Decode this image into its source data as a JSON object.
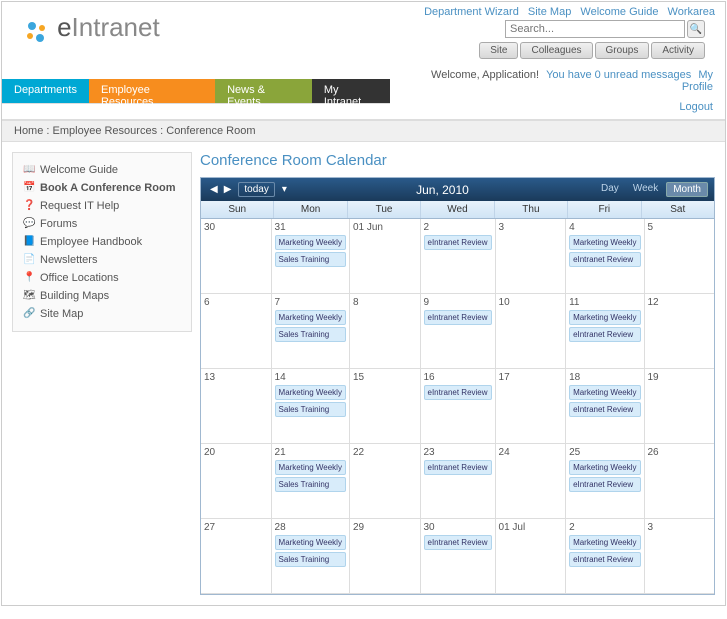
{
  "topLinks": {
    "deptWizard": "Department Wizard",
    "siteMap": "Site Map",
    "welcomeGuide": "Welcome Guide",
    "workarea": "Workarea"
  },
  "search": {
    "placeholder": "Search..."
  },
  "filterTabs": {
    "site": "Site",
    "colleagues": "Colleagues",
    "groups": "Groups",
    "activity": "Activity"
  },
  "logo": {
    "e": "e",
    "rest": "Intranet"
  },
  "nav": {
    "departments": "Departments",
    "employee": "Employee Resources",
    "news": "News & Events",
    "my": "My Intranet"
  },
  "userBar": {
    "welcome": "Welcome, Application!",
    "messages": "You have 0 unread messages",
    "profile": "My Profile",
    "logout": "Logout"
  },
  "breadcrumb": {
    "home": "Home",
    "sep1": " : ",
    "emp": "Employee Resources",
    "sep2": " : ",
    "room": "Conference Room"
  },
  "sidebar": {
    "welcome": "Welcome Guide",
    "book": "Book A Conference Room",
    "it": "Request IT Help",
    "forums": "Forums",
    "handbook": "Employee Handbook",
    "newsletters": "Newsletters",
    "office": "Office Locations",
    "maps": "Building Maps",
    "sitemap": "Site Map"
  },
  "pageTitle": "Conference Room Calendar",
  "cal": {
    "today": "today",
    "title": "Jun, 2010",
    "dayView": "Day",
    "weekView": "Week",
    "monthView": "Month",
    "dow": [
      "Sun",
      "Mon",
      "Tue",
      "Wed",
      "Thu",
      "Fri",
      "Sat"
    ],
    "weeks": [
      [
        {
          "d": "30"
        },
        {
          "d": "31",
          "ev": [
            "Marketing Weekly",
            "Sales Training"
          ]
        },
        {
          "d": "01 Jun"
        },
        {
          "d": "2",
          "ev": [
            "eIntranet Review"
          ]
        },
        {
          "d": "3"
        },
        {
          "d": "4",
          "ev": [
            "Marketing Weekly",
            "eIntranet Review"
          ]
        },
        {
          "d": "5"
        }
      ],
      [
        {
          "d": "6"
        },
        {
          "d": "7",
          "ev": [
            "Marketing Weekly",
            "Sales Training"
          ]
        },
        {
          "d": "8"
        },
        {
          "d": "9",
          "ev": [
            "eIntranet Review"
          ]
        },
        {
          "d": "10"
        },
        {
          "d": "11",
          "ev": [
            "Marketing Weekly",
            "eIntranet Review"
          ]
        },
        {
          "d": "12"
        }
      ],
      [
        {
          "d": "13"
        },
        {
          "d": "14",
          "ev": [
            "Marketing Weekly",
            "Sales Training"
          ]
        },
        {
          "d": "15"
        },
        {
          "d": "16",
          "ev": [
            "eIntranet Review"
          ]
        },
        {
          "d": "17"
        },
        {
          "d": "18",
          "ev": [
            "Marketing Weekly",
            "eIntranet Review"
          ]
        },
        {
          "d": "19"
        }
      ],
      [
        {
          "d": "20"
        },
        {
          "d": "21",
          "ev": [
            "Marketing Weekly",
            "Sales Training"
          ]
        },
        {
          "d": "22"
        },
        {
          "d": "23",
          "ev": [
            "eIntranet Review"
          ]
        },
        {
          "d": "24"
        },
        {
          "d": "25",
          "ev": [
            "Marketing Weekly",
            "eIntranet Review"
          ]
        },
        {
          "d": "26"
        }
      ],
      [
        {
          "d": "27"
        },
        {
          "d": "28",
          "ev": [
            "Marketing Weekly",
            "Sales Training"
          ]
        },
        {
          "d": "29"
        },
        {
          "d": "30",
          "ev": [
            "eIntranet Review"
          ]
        },
        {
          "d": "01 Jul"
        },
        {
          "d": "2",
          "ev": [
            "Marketing Weekly",
            "eIntranet Review"
          ]
        },
        {
          "d": "3"
        }
      ]
    ]
  }
}
